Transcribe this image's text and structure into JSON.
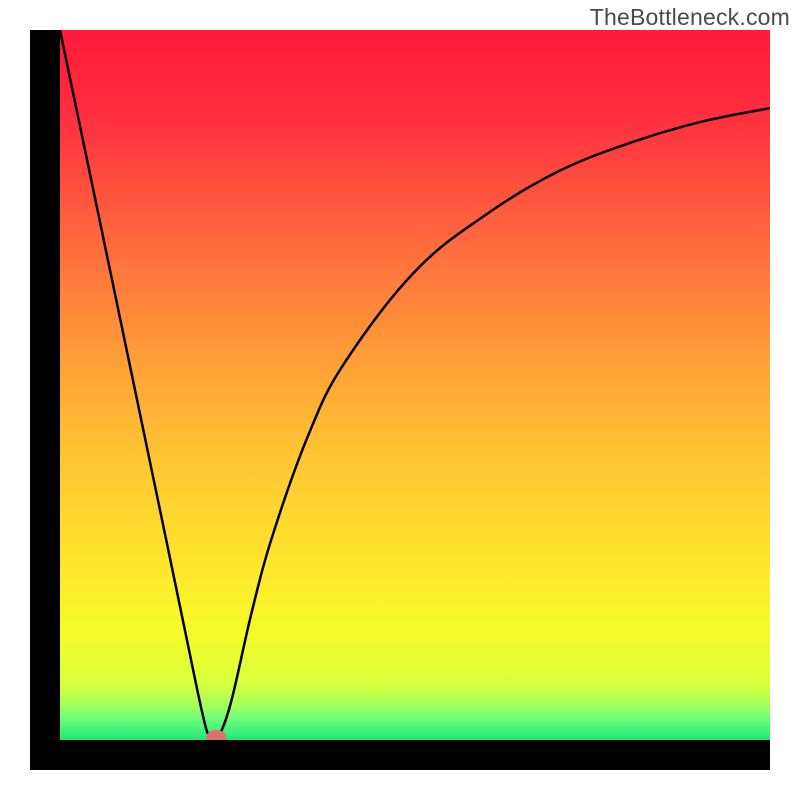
{
  "watermark": "TheBottleneck.com",
  "chart_data": {
    "type": "line",
    "title": "",
    "xlabel": "",
    "ylabel": "",
    "xlim": [
      0,
      100
    ],
    "ylim": [
      0,
      100
    ],
    "series": [
      {
        "name": "bottleneck-curve",
        "x": [
          0,
          5,
          10,
          15,
          18,
          20,
          21,
          22,
          24,
          27,
          30,
          35,
          40,
          50,
          60,
          70,
          80,
          90,
          100
        ],
        "values": [
          100,
          76,
          52,
          28,
          13.5,
          4,
          0.5,
          0,
          5,
          18,
          29,
          43,
          53,
          66,
          74,
          80,
          84,
          87,
          89
        ]
      }
    ],
    "marker": {
      "x": 22,
      "y": 0
    },
    "gradient": {
      "direction": "top-to-bottom",
      "stops": [
        {
          "pct": 0,
          "color": "#ff1a3a"
        },
        {
          "pct": 12,
          "color": "#ff2e3f"
        },
        {
          "pct": 30,
          "color": "#ff6a3e"
        },
        {
          "pct": 45,
          "color": "#ff9a38"
        },
        {
          "pct": 60,
          "color": "#ffc532"
        },
        {
          "pct": 75,
          "color": "#ffe52d"
        },
        {
          "pct": 85,
          "color": "#f6fb2a"
        },
        {
          "pct": 92,
          "color": "#d8ff3b"
        },
        {
          "pct": 95,
          "color": "#a7ff5a"
        },
        {
          "pct": 97,
          "color": "#6cff7e"
        },
        {
          "pct": 100,
          "color": "#22e674"
        }
      ]
    }
  }
}
